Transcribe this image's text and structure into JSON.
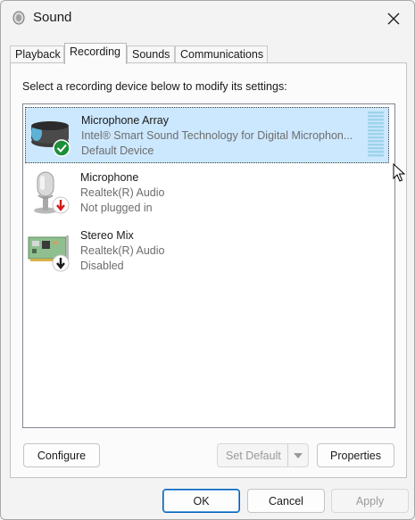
{
  "window": {
    "title": "Sound"
  },
  "tabs": [
    {
      "label": "Playback",
      "active": false
    },
    {
      "label": "Recording",
      "active": true
    },
    {
      "label": "Sounds",
      "active": false
    },
    {
      "label": "Communications",
      "active": false
    }
  ],
  "recording": {
    "instruction": "Select a recording device below to modify its settings:",
    "devices": [
      {
        "name": "Microphone Array",
        "description": "Intel® Smart Sound Technology for Digital Microphon...",
        "status": "Default Device",
        "selected": true,
        "status_badge": "check-icon"
      },
      {
        "name": "Microphone",
        "description": "Realtek(R) Audio",
        "status": "Not plugged in",
        "selected": false,
        "status_badge": "red-down-arrow-icon"
      },
      {
        "name": "Stereo Mix",
        "description": "Realtek(R) Audio",
        "status": "Disabled",
        "selected": false,
        "status_badge": "black-down-arrow-icon"
      }
    ],
    "buttons": {
      "configure": "Configure",
      "set_default": "Set Default",
      "properties": "Properties"
    }
  },
  "dialog_buttons": {
    "ok": "OK",
    "cancel": "Cancel",
    "apply": "Apply"
  },
  "colors": {
    "selection": "#cce8ff",
    "accent": "#005fb8",
    "default_badge": "#1d8f3a",
    "unplugged_badge": "#d01c1c"
  }
}
